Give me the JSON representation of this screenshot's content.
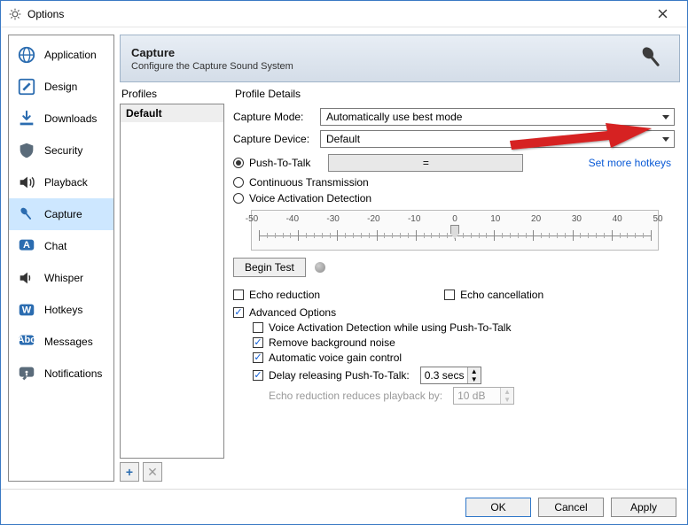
{
  "window": {
    "title": "Options"
  },
  "sidebar": {
    "items": [
      {
        "label": "Application",
        "icon": "globe-icon"
      },
      {
        "label": "Design",
        "icon": "pencil-icon"
      },
      {
        "label": "Downloads",
        "icon": "download-icon"
      },
      {
        "label": "Security",
        "icon": "shield-icon"
      },
      {
        "label": "Playback",
        "icon": "speaker-icon"
      },
      {
        "label": "Capture",
        "icon": "microphone-icon",
        "selected": true
      },
      {
        "label": "Chat",
        "icon": "chat-icon"
      },
      {
        "label": "Whisper",
        "icon": "whisper-icon"
      },
      {
        "label": "Hotkeys",
        "icon": "hotkeys-icon"
      },
      {
        "label": "Messages",
        "icon": "messages-icon"
      },
      {
        "label": "Notifications",
        "icon": "notifications-icon"
      }
    ]
  },
  "header": {
    "title": "Capture",
    "subtitle": "Configure the Capture Sound System"
  },
  "profiles": {
    "label": "Profiles",
    "items": [
      "Default"
    ],
    "add_tooltip": "+",
    "remove_tooltip": "✕"
  },
  "details": {
    "label": "Profile Details",
    "capture_mode": {
      "label": "Capture Mode:",
      "value": "Automatically use best mode"
    },
    "capture_device": {
      "label": "Capture Device:",
      "value": "Default"
    },
    "modes": {
      "ptt": "Push-To-Talk",
      "ct": "Continuous Transmission",
      "vad": "Voice Activation Detection",
      "selected": "ptt"
    },
    "hotkey": {
      "value": "="
    },
    "more_hotkeys": "Set more hotkeys",
    "vad_labels": [
      "-50",
      "-40",
      "-30",
      "-20",
      "-10",
      "0",
      "10",
      "20",
      "30",
      "40",
      "50"
    ],
    "vad_value": 0,
    "begin_test": "Begin Test",
    "echo_reduction": {
      "label": "Echo reduction",
      "checked": false
    },
    "echo_cancellation": {
      "label": "Echo cancellation",
      "checked": false
    },
    "advanced": {
      "label": "Advanced Options",
      "checked": true,
      "vad_while_ptt": {
        "label": "Voice Activation Detection while using Push-To-Talk",
        "checked": false
      },
      "remove_noise": {
        "label": "Remove background noise",
        "checked": true
      },
      "agc": {
        "label": "Automatic voice gain control",
        "checked": true
      },
      "delay_ptt": {
        "label": "Delay releasing Push-To-Talk:",
        "checked": true,
        "value": "0.3 secs"
      },
      "echo_reduction_amount": {
        "label": "Echo reduction reduces playback by:",
        "value": "10 dB",
        "enabled": false
      }
    }
  },
  "footer": {
    "ok": "OK",
    "cancel": "Cancel",
    "apply": "Apply"
  }
}
